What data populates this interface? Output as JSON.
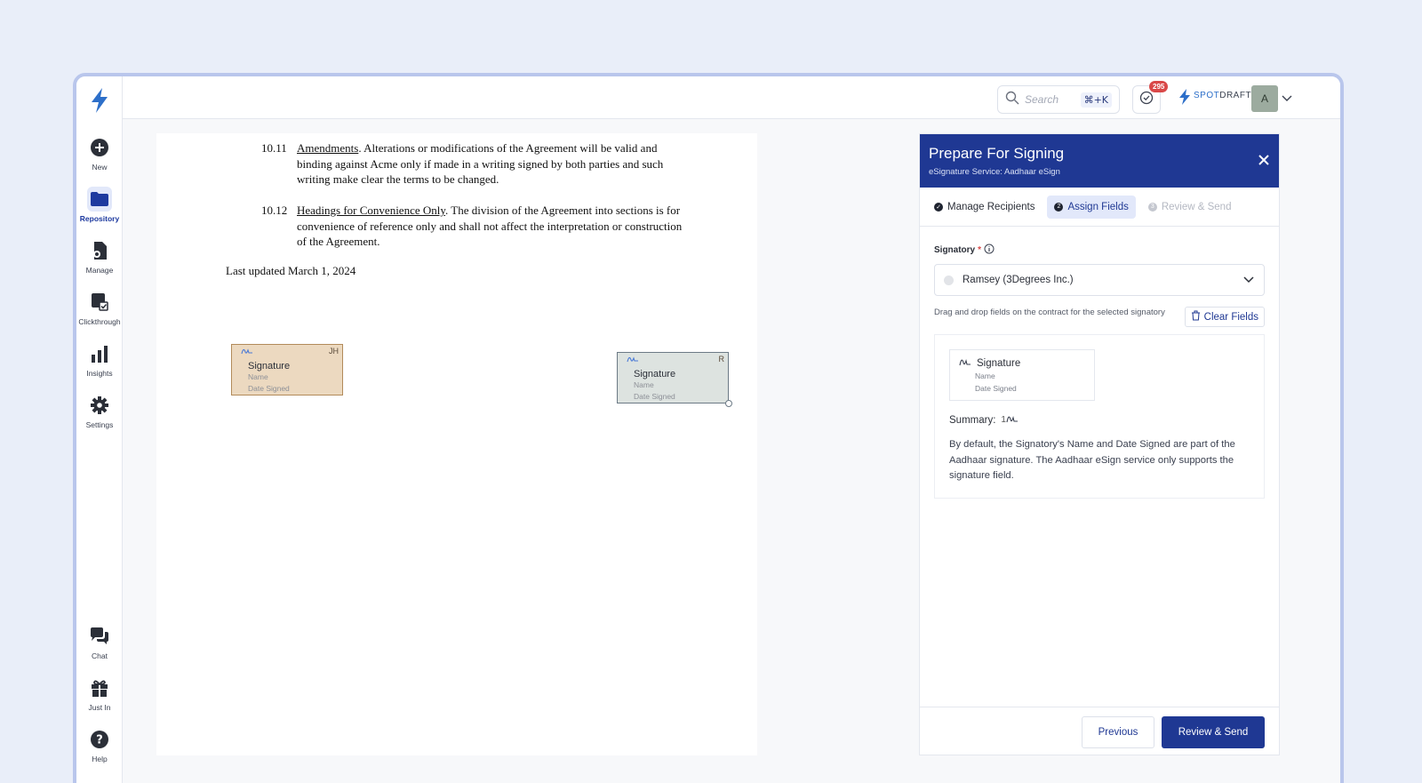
{
  "sidebar": {
    "items": [
      {
        "label": "New",
        "icon": "plus-circle-icon"
      },
      {
        "label": "Repository",
        "icon": "folder-icon"
      },
      {
        "label": "Manage",
        "icon": "manage-doc-icon"
      },
      {
        "label": "Clickthrough",
        "icon": "clickthrough-icon"
      },
      {
        "label": "Insights",
        "icon": "bar-chart-icon"
      },
      {
        "label": "Settings",
        "icon": "gear-icon"
      },
      {
        "label": "Chat",
        "icon": "chat-icon"
      },
      {
        "label": "Just In",
        "icon": "gift-icon"
      },
      {
        "label": "Help",
        "icon": "help-icon"
      }
    ],
    "active": "Repository"
  },
  "topbar": {
    "search_placeholder": "Search",
    "search_shortcut": "⌘+K",
    "tasks_badge": "295",
    "brand_prefix": "SPOT",
    "brand_suffix": "DRAFT",
    "avatar_initial": "A"
  },
  "document": {
    "clauses": [
      {
        "num": "10.11",
        "heading": "Amendments",
        "text": ". Alterations or modifications of the Agreement will be valid and binding against Acme only if made in a writing signed by both parties and such writing make clear the terms to be changed."
      },
      {
        "num": "10.12",
        "heading": "Headings for Convenience Only",
        "text": ". The division of the Agreement into sections is for convenience of reference only and shall not affect the interpretation or construction of the Agreement."
      }
    ],
    "last_updated": "Last updated March 1, 2024",
    "signature_boxes": [
      {
        "initials": "JH",
        "title": "Signature",
        "name_label": "Name",
        "date_label": "Date Signed"
      },
      {
        "initials": "R",
        "title": "Signature",
        "name_label": "Name",
        "date_label": "Date Signed"
      }
    ]
  },
  "panel": {
    "title": "Prepare For Signing",
    "subtitle": "eSignature Service: Aadhaar eSign",
    "steps": [
      {
        "label": "Manage Recipients",
        "state": "done"
      },
      {
        "label": "Assign Fields",
        "state": "active"
      },
      {
        "label": "Review & Send",
        "state": "disabled"
      }
    ],
    "signatory_label": "Signatory",
    "signatory_value": "Ramsey (3Degrees Inc.)",
    "hint": "Drag and drop fields on the contract for the selected signatory",
    "clear_fields": "Clear Fields",
    "field": {
      "title": "Signature",
      "name_label": "Name",
      "date_label": "Date Signed"
    },
    "summary_label": "Summary:",
    "summary_count": "1",
    "description": "By default, the Signatory's Name and Date Signed are part of the Aadhaar signature. The Aadhaar eSign service only supports the signature field.",
    "previous_label": "Previous",
    "next_label": "Review & Send"
  },
  "colors": {
    "primary": "#1f3893",
    "accent_blue": "#2d6fc9",
    "badge": "#d94848",
    "sig_box_1": "#ecd9c0",
    "sig_box_2": "#dde3e0"
  }
}
